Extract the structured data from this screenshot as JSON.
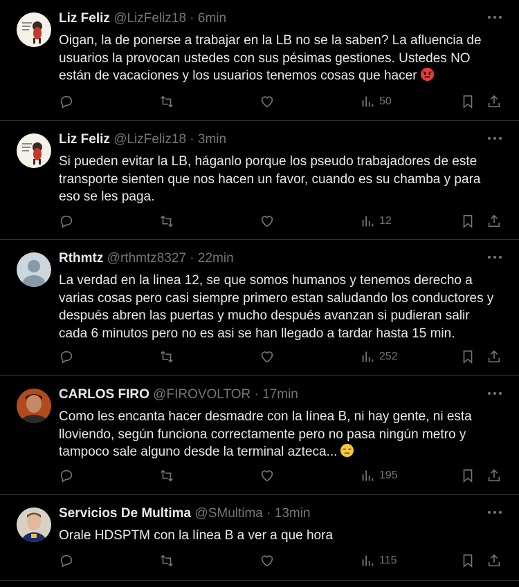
{
  "tweets": [
    {
      "name": "Liz Feliz",
      "handle": "@LizFeliz18",
      "time": "6min",
      "text": "Oigan, la de ponerse a trabajar en la LB no se la saben? La afluencia de usuarios la provocan ustedes con sus pésimas gestiones. Ustedes NO están de vacaciones y los usuarios tenemos cosas que hacer",
      "emoji": "angry-face",
      "views": "50",
      "avatar": "illustrated-character"
    },
    {
      "name": "Liz Feliz",
      "handle": "@LizFeliz18",
      "time": "3min",
      "text": "Si pueden evitar la LB, háganlo porque los pseudo trabajadores de este transporte sienten que nos hacen un favor, cuando es su chamba y para eso se les paga.",
      "emoji": "",
      "views": "12",
      "avatar": "illustrated-character"
    },
    {
      "name": "Rthmtz",
      "handle": "@rthmtz8327",
      "time": "22min",
      "text": "La verdad en la linea 12, se que somos humanos y tenemos derecho a varias cosas pero casi siempre primero estan saludando los conductores y después abren las puertas y mucho después avanzan si pudieran salir cada 6 minutos pero no es asi se han llegado a tardar hasta 15 min.",
      "emoji": "",
      "views": "252",
      "avatar": "default-profile"
    },
    {
      "name": "CARLOS FIRO",
      "handle": "@FIROVOLTOR",
      "time": "17min",
      "text": "Como les encanta hacer desmadre con la línea B, ni hay gente, ni esta lloviendo, según funciona correctamente pero no pasa ningún metro y tampoco sale alguno desde la terminal azteca...",
      "emoji": "unamused-face",
      "views": "195",
      "avatar": "person-photo"
    },
    {
      "name": "Servicios De Multima",
      "handle": "@SMultima",
      "time": "13min",
      "text": "Orale HDSPTM con la línea B a ver a que hora",
      "emoji": "",
      "views": "115",
      "avatar": "person-photo"
    }
  ],
  "colors": {
    "background": "#000000",
    "text": "#e7e9ea",
    "muted": "#71767b",
    "divider": "#2f3336"
  },
  "icons": [
    "reply-icon",
    "retweet-icon",
    "like-icon",
    "views-icon",
    "bookmark-icon",
    "share-icon",
    "more-icon"
  ]
}
